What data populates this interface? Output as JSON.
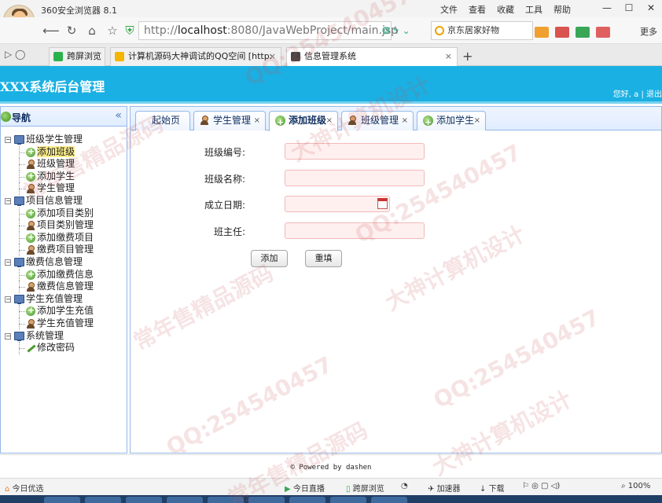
{
  "browser": {
    "title": "360安全浏览器 8.1",
    "menu": [
      "文件",
      "查看",
      "收藏",
      "工具",
      "帮助"
    ],
    "url_prefix": "http://",
    "url_host": "localhost",
    "url_rest": ":8080/JavaWebProject/main.jsp",
    "search_text": "京东居家好物",
    "more_label": "更多",
    "tabs": [
      {
        "label": "跨屏浏览",
        "color": "#2bb24c"
      },
      {
        "label": "计算机源码大神调试的QQ空间 [http:",
        "color": "#f4b400"
      },
      {
        "label": "信息管理系统",
        "color": "#444444"
      }
    ]
  },
  "header": {
    "title": "XXX系统后台管理",
    "user_text": "您好, a | 退出"
  },
  "nav": {
    "title": "导航",
    "collapse_glyph": "«",
    "tree": [
      {
        "type": "group",
        "label": "班级学生管理"
      },
      {
        "type": "leaf",
        "icon": "add",
        "label": "添加班级",
        "selected": true
      },
      {
        "type": "leaf",
        "icon": "user",
        "label": "班级管理"
      },
      {
        "type": "leaf",
        "icon": "add",
        "label": "添加学生"
      },
      {
        "type": "leaf",
        "icon": "user",
        "label": "学生管理"
      },
      {
        "type": "group",
        "label": "项目信息管理"
      },
      {
        "type": "leaf",
        "icon": "add",
        "label": "添加项目类别"
      },
      {
        "type": "leaf",
        "icon": "user",
        "label": "项目类别管理"
      },
      {
        "type": "leaf",
        "icon": "add",
        "label": "添加缴费项目"
      },
      {
        "type": "leaf",
        "icon": "user",
        "label": "缴费项目管理"
      },
      {
        "type": "group",
        "label": "缴费信息管理"
      },
      {
        "type": "leaf",
        "icon": "add",
        "label": "添加缴费信息"
      },
      {
        "type": "leaf",
        "icon": "user",
        "label": "缴费信息管理"
      },
      {
        "type": "group",
        "label": "学生充值管理"
      },
      {
        "type": "leaf",
        "icon": "add",
        "label": "添加学生充值"
      },
      {
        "type": "leaf",
        "icon": "user",
        "label": "学生充值管理"
      },
      {
        "type": "group",
        "label": "系统管理"
      },
      {
        "type": "leaf",
        "icon": "pencil",
        "label": "修改密码"
      }
    ]
  },
  "content_tabs": [
    {
      "label": "起始页",
      "icon": "none",
      "closable": false
    },
    {
      "label": "学生管理",
      "icon": "user",
      "closable": true
    },
    {
      "label": "添加班级",
      "icon": "add",
      "closable": true,
      "active": true
    },
    {
      "label": "班级管理",
      "icon": "user",
      "closable": true
    },
    {
      "label": "添加学生",
      "icon": "add",
      "closable": true
    }
  ],
  "form": {
    "fields": [
      {
        "label": "班级编号:",
        "value": ""
      },
      {
        "label": "班级名称:",
        "value": ""
      },
      {
        "label": "成立日期:",
        "value": "",
        "has_calendar": true
      },
      {
        "label": "班主任:",
        "value": ""
      }
    ],
    "add_button": "添加",
    "reset_button": "重填"
  },
  "footer": {
    "powered": "© Powered by dashen"
  },
  "statusbar": {
    "left": "今日优选",
    "items": [
      "今日直播",
      "跨屏浏览",
      "加速器",
      "下载",
      "100%"
    ]
  },
  "watermarks": [
    "QQ:254540457",
    "大神计算机设计",
    "常年售精品源码",
    "QQ:254540457",
    "大神计算机设计",
    "常年售精品源码",
    "QQ:254540457",
    "大神计算机设计",
    "QQ:254540457",
    "常年售精品源码"
  ]
}
